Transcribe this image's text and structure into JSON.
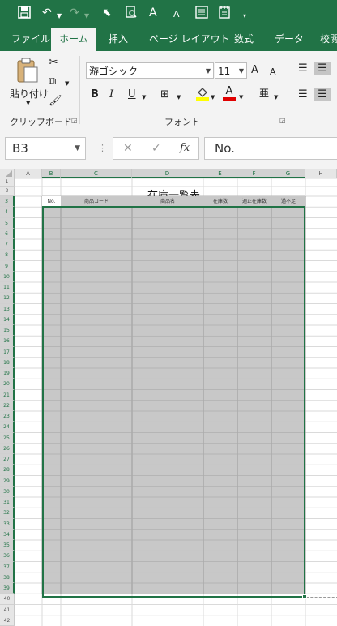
{
  "qat": {
    "save_icon": "save-icon",
    "undo_icon": "undo-icon",
    "redo_icon": "redo-icon",
    "select_icon": "select-pointer-icon",
    "preview_icon": "print-preview-icon",
    "font_up_label": "A",
    "font_down_label": "A",
    "form_icon": "form-icon",
    "doc_icon": "document-icon",
    "customize_icon": "customize-qat-icon"
  },
  "tabs": [
    {
      "label": "ファイル"
    },
    {
      "label": "ホーム"
    },
    {
      "label": "挿入"
    },
    {
      "label": "ページ レイアウト"
    },
    {
      "label": "数式"
    },
    {
      "label": "データ"
    },
    {
      "label": "校閲"
    }
  ],
  "ribbon": {
    "clipboard": {
      "paste_label": "貼り付け",
      "group_label": "クリップボード"
    },
    "font": {
      "font_name": "游ゴシック",
      "font_size": "11",
      "bold": "B",
      "italic": "I",
      "underline": "U",
      "grow": "A",
      "shrink": "A",
      "color_letter": "A",
      "group_label": "フォント"
    }
  },
  "formula_bar": {
    "name_box": "B3",
    "cancel": "✕",
    "enter": "✓",
    "fx": "fx",
    "content": "No."
  },
  "sheet": {
    "columns": [
      "A",
      "B",
      "C",
      "D",
      "E",
      "F",
      "G",
      "H"
    ],
    "rows": [
      "1",
      "2",
      "3",
      "4",
      "5",
      "6",
      "7",
      "8",
      "9",
      "10",
      "11",
      "12",
      "13",
      "14",
      "15",
      "16",
      "17",
      "18",
      "19",
      "20",
      "21",
      "22",
      "23",
      "24",
      "25",
      "26",
      "27",
      "28",
      "29",
      "30",
      "31",
      "32",
      "33",
      "34",
      "35",
      "36",
      "37",
      "38",
      "39",
      "40",
      "41",
      "42"
    ],
    "title": "在庫一覧表",
    "headers": [
      "No.",
      "商品コード",
      "商品名",
      "在庫数",
      "適正在庫数",
      "過不足"
    ],
    "selection_color": "#217346",
    "fill_color": "#c8c8c8"
  }
}
